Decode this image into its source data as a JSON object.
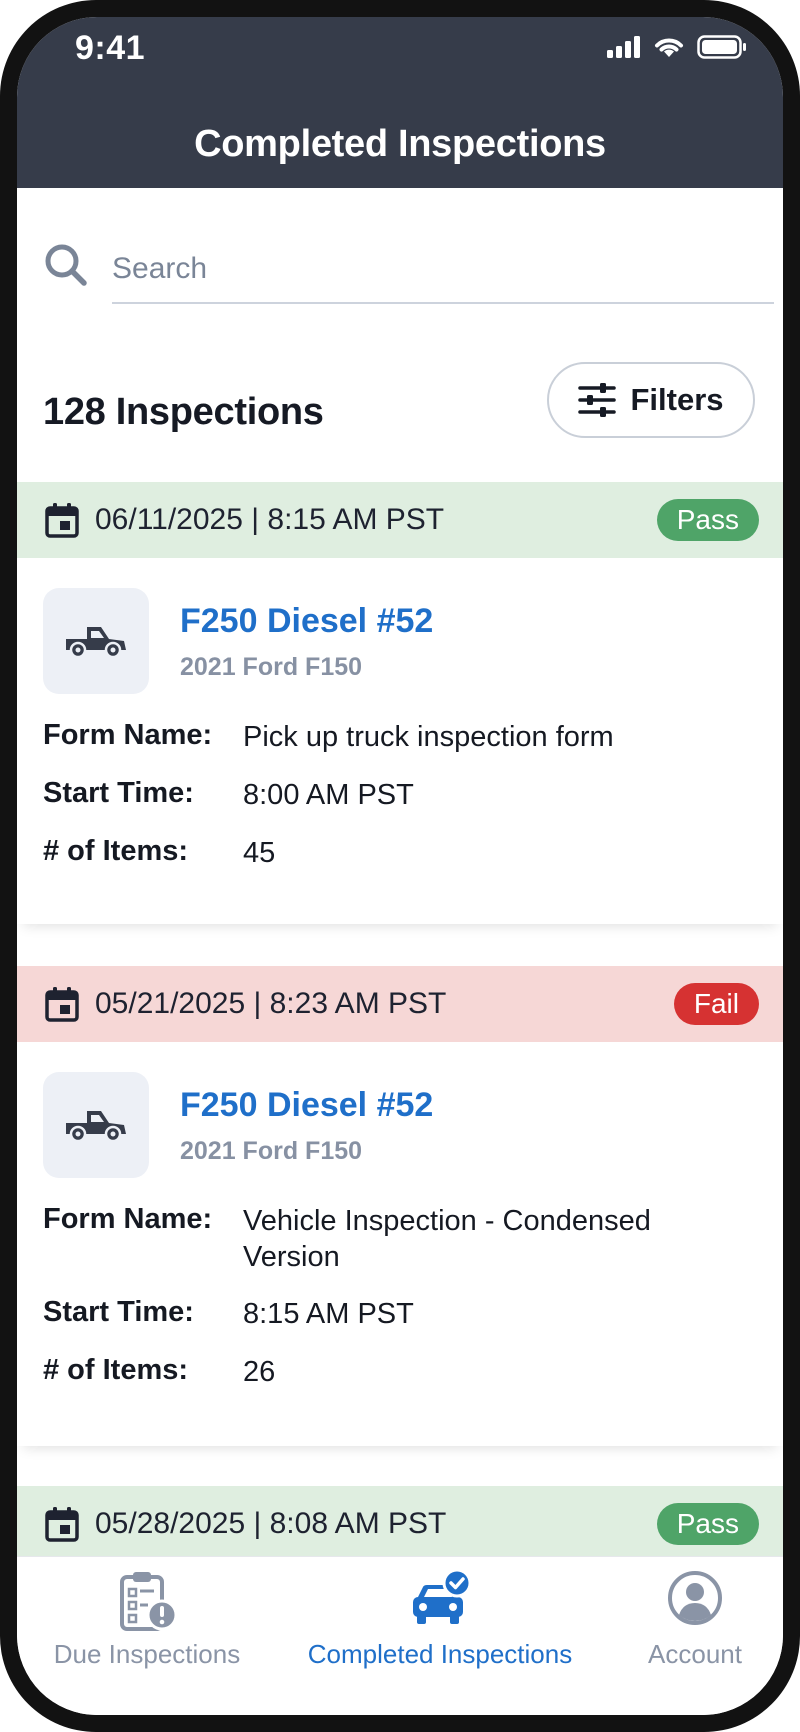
{
  "status_bar": {
    "time": "9:41"
  },
  "header": {
    "title": "Completed Inspections"
  },
  "search": {
    "placeholder": "Search"
  },
  "summary": {
    "count_label": "128 Inspections",
    "filters_label": "Filters"
  },
  "labels": {
    "form_name": "Form Name:",
    "start_time": "Start Time:",
    "items": "# of Items:"
  },
  "inspections": [
    {
      "datetime": "06/11/2025 | 8:15 AM PST",
      "result": "Pass",
      "vehicle_name": "F250 Diesel #52",
      "vehicle_model": "2021 Ford F150",
      "form_name": "Pick up truck inspection form",
      "start_time": "8:00 AM PST",
      "items": "45"
    },
    {
      "datetime": "05/21/2025 | 8:23 AM PST",
      "result": "Fail",
      "vehicle_name": "F250 Diesel #52",
      "vehicle_model": "2021 Ford F150",
      "form_name": "Vehicle Inspection - Condensed Version",
      "start_time": "8:15 AM PST",
      "items": "26"
    },
    {
      "datetime": "05/28/2025 | 8:08 AM PST",
      "result": "Pass"
    }
  ],
  "tabs": [
    {
      "label": "Due Inspections",
      "icon": "clipboard-alert-icon",
      "active": false
    },
    {
      "label": "Completed Inspections",
      "icon": "car-check-icon",
      "active": true
    },
    {
      "label": "Account",
      "icon": "account-icon",
      "active": false
    }
  ],
  "colors": {
    "header_bg": "#363c4a",
    "accent": "#1f6fc9",
    "pass_band": "#dfeee0",
    "pass_badge": "#4fa468",
    "fail_band": "#f6d7d6",
    "fail_badge": "#d63232",
    "inactive_tab": "#8a94a6"
  }
}
